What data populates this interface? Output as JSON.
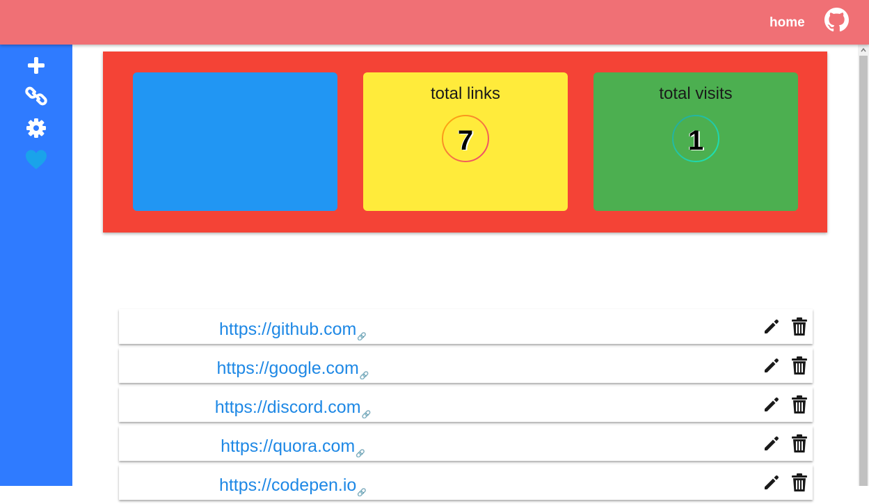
{
  "header": {
    "home_label": "home",
    "github_icon": "github-icon",
    "background": "#f07075"
  },
  "sidebar": {
    "background": "#2f7bff",
    "icons": [
      "plus-icon",
      "link-icon",
      "gear-icon",
      "heart-icon"
    ]
  },
  "stats": {
    "background": "#f44336",
    "cards": [
      {
        "color": "#2196f3"
      },
      {
        "title": "total links",
        "value": "7",
        "color": "#ffeb3b"
      },
      {
        "title": "total visits",
        "value": "1",
        "color": "#4caf50"
      }
    ]
  },
  "links": [
    {
      "url": "https://github.com",
      "glyph": "🔗"
    },
    {
      "url": "https://google.com",
      "glyph": "🔗"
    },
    {
      "url": "https://discord.com",
      "glyph": "🔗"
    },
    {
      "url": "https://quora.com",
      "glyph": "🔗"
    },
    {
      "url": "https://codepen.io",
      "glyph": "🔗"
    }
  ],
  "colors": {
    "link": "#1e88e5",
    "accent": "#f07075"
  }
}
